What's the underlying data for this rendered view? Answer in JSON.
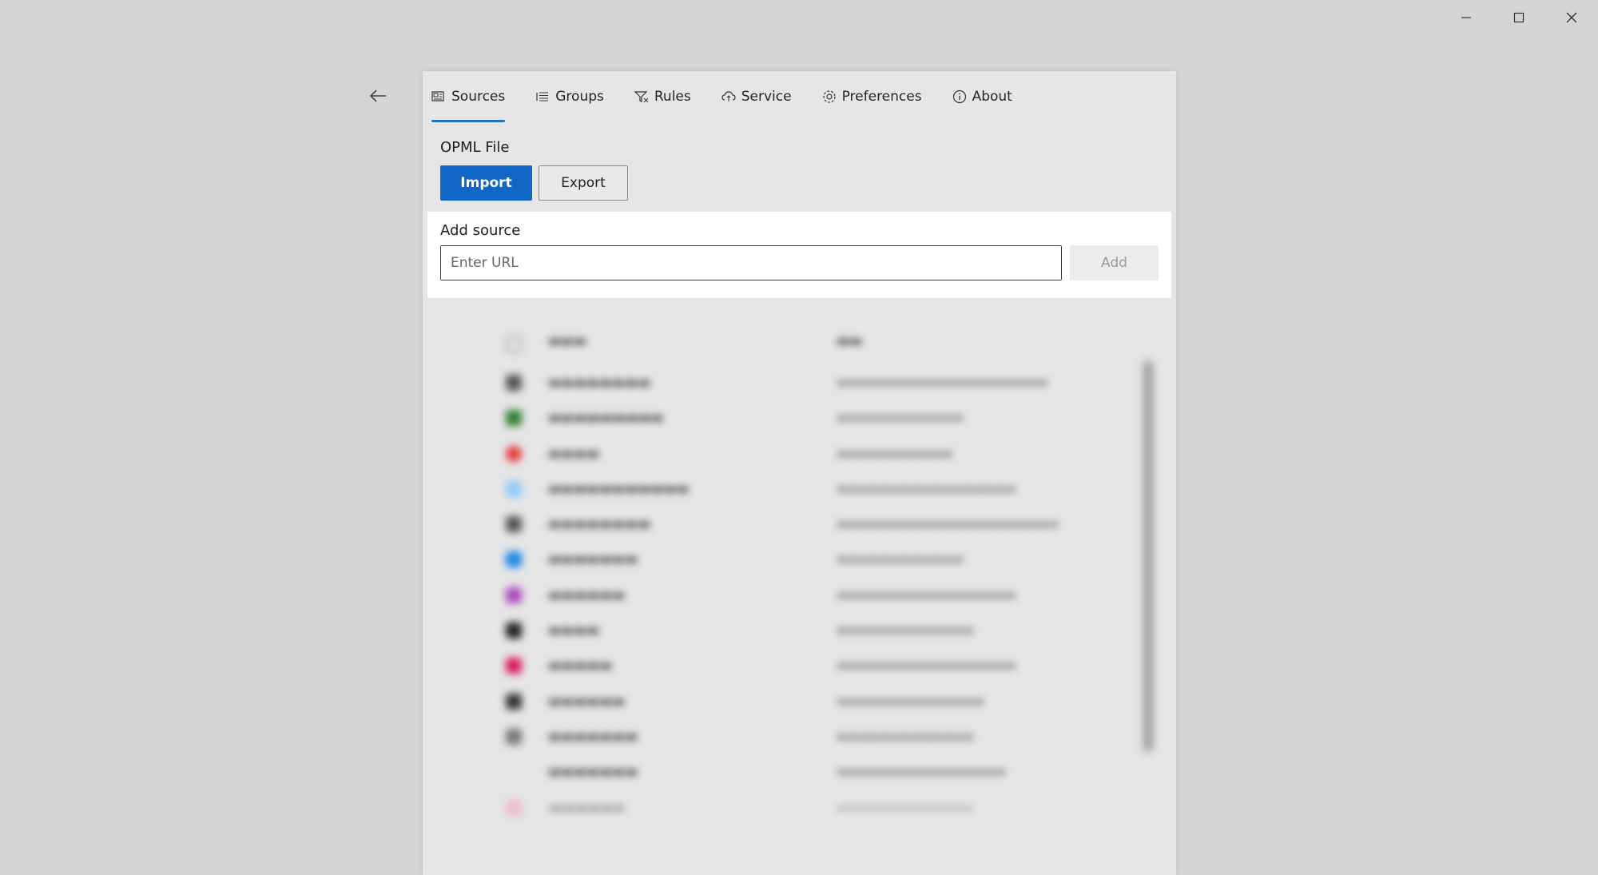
{
  "window": {
    "controls": {
      "minimize_icon": "minimize-icon",
      "maximize_icon": "maximize-icon",
      "close_icon": "close-icon"
    }
  },
  "nav": {
    "back_icon": "back-arrow-icon"
  },
  "tabs": [
    {
      "label": "Sources",
      "icon": "sources-icon",
      "active": true
    },
    {
      "label": "Groups",
      "icon": "groups-icon",
      "active": false
    },
    {
      "label": "Rules",
      "icon": "rules-icon",
      "active": false
    },
    {
      "label": "Service",
      "icon": "service-icon",
      "active": false
    },
    {
      "label": "Preferences",
      "icon": "preferences-icon",
      "active": false
    },
    {
      "label": "About",
      "icon": "about-icon",
      "active": false
    }
  ],
  "opml": {
    "label": "OPML File",
    "import_label": "Import",
    "export_label": "Export"
  },
  "add_source": {
    "label": "Add source",
    "placeholder": "Enter URL",
    "add_label": "Add"
  },
  "colors": {
    "accent": "#0f66c4",
    "tab_underline": "#2b6fc4",
    "panel_bg": "#e6e6e6",
    "backdrop": "#d6d5d4"
  }
}
